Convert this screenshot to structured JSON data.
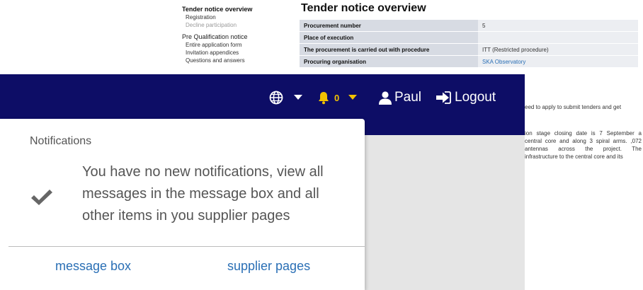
{
  "left_nav": {
    "heading": "Tender notice overview",
    "items": [
      {
        "label": "Registration",
        "disabled": false
      },
      {
        "label": "Decline participation",
        "disabled": true
      }
    ],
    "section": "Pre Qualification notice",
    "section_items": [
      "Entire application form",
      "Invitation appendices",
      "Questions and answers"
    ]
  },
  "main": {
    "title": "Tender notice overview",
    "rows": [
      {
        "label": "Procurement number",
        "value": "5"
      },
      {
        "label": "Place of execution",
        "value": ""
      },
      {
        "label": "The procurement is carried out with procedure",
        "value": "ITT (Restricted procedure)"
      },
      {
        "label": "Procuring organisation",
        "value": "SKA Observatory"
      }
    ],
    "desc_1": "eed to apply to submit tenders and get",
    "desc_2": "ion stage closing date is 7 September a central core and along 3 spiral arms. ,072 antennas across the project. The infrastructure to the central core and its"
  },
  "navbar": {
    "bell_count": "0",
    "user_name": "Paul",
    "logout_label": "Logout",
    "icons": [
      "globe-icon",
      "chevron-down-icon",
      "bell-icon",
      "user-icon",
      "logout-icon"
    ],
    "bg_color": "#0d0d66",
    "bell_color": "#f2c200"
  },
  "notifications": {
    "title": "Notifications",
    "message": "You have no new notifications, view all messages in the message box and all other items in you supplier pages",
    "links": {
      "message_box": "message box",
      "supplier_pages": "supplier pages"
    },
    "link_color": "#2a6fb5"
  }
}
